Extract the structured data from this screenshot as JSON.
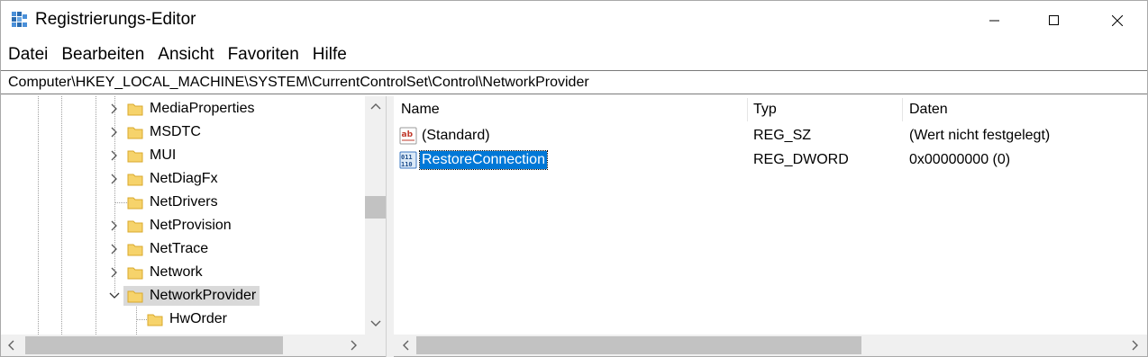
{
  "window": {
    "title": "Registrierungs-Editor",
    "icon": "regedit-icon"
  },
  "menu": [
    "Datei",
    "Bearbeiten",
    "Ansicht",
    "Favoriten",
    "Hilfe"
  ],
  "address": "Computer\\HKEY_LOCAL_MACHINE\\SYSTEM\\CurrentControlSet\\Control\\NetworkProvider",
  "tree": {
    "items": [
      {
        "label": "MediaProperties",
        "expander": "collapsed"
      },
      {
        "label": "MSDTC",
        "expander": "collapsed"
      },
      {
        "label": "MUI",
        "expander": "collapsed"
      },
      {
        "label": "NetDiagFx",
        "expander": "collapsed"
      },
      {
        "label": "NetDrivers",
        "expander": "none"
      },
      {
        "label": "NetProvision",
        "expander": "collapsed"
      },
      {
        "label": "NetTrace",
        "expander": "collapsed"
      },
      {
        "label": "Network",
        "expander": "collapsed"
      },
      {
        "label": "NetworkProvider",
        "expander": "expanded",
        "selected": true
      },
      {
        "label": "HwOrder",
        "expander": "none",
        "child": true
      }
    ]
  },
  "list": {
    "columns": [
      "Name",
      "Typ",
      "Daten"
    ],
    "rows": [
      {
        "name": "(Standard)",
        "type": "REG_SZ",
        "data": "(Wert nicht festgelegt)",
        "icon": "string-value-icon"
      },
      {
        "name": "RestoreConnection",
        "type": "REG_DWORD",
        "data": "0x00000000 (0)",
        "icon": "binary-value-icon",
        "selected": true
      }
    ]
  },
  "colors": {
    "selection": "#0078d7",
    "tree_selection": "#d9d9d9",
    "folder": "#f6d36b"
  }
}
